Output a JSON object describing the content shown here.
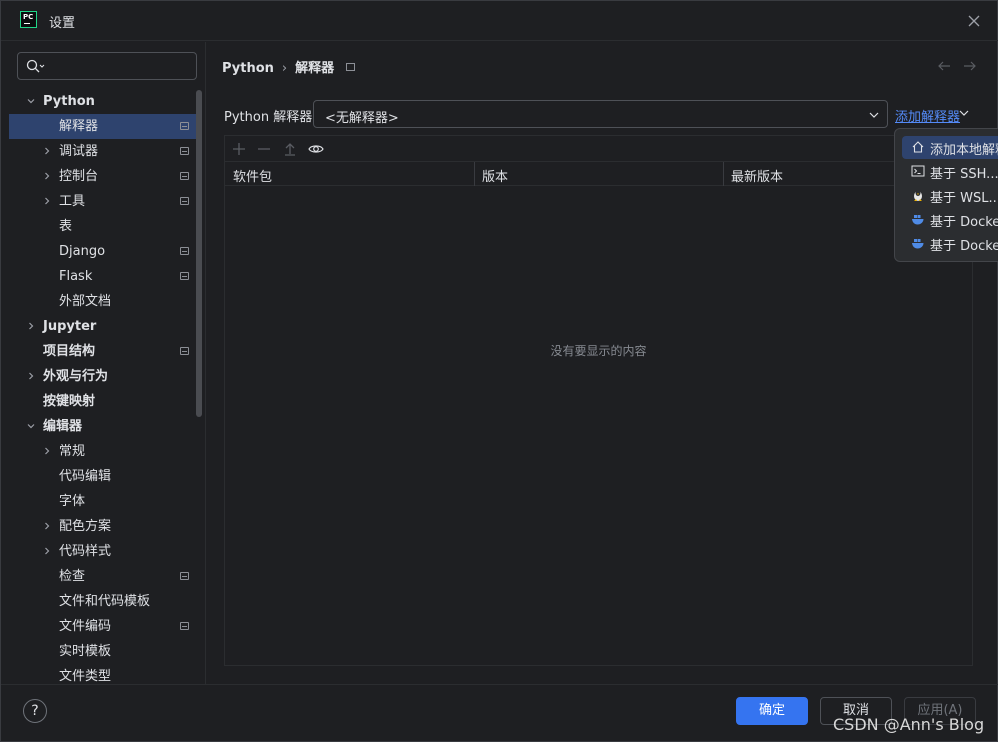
{
  "window": {
    "title": "设置"
  },
  "sidebar": {
    "search_placeholder": "",
    "items": [
      {
        "label": "Python",
        "level": 0,
        "expanded": true,
        "bold": true,
        "pinned": false,
        "selected": false
      },
      {
        "label": "解释器",
        "level": 1,
        "expanded": null,
        "bold": false,
        "pinned": true,
        "selected": true
      },
      {
        "label": "调试器",
        "level": 1,
        "expanded": false,
        "bold": false,
        "pinned": true,
        "selected": false
      },
      {
        "label": "控制台",
        "level": 1,
        "expanded": false,
        "bold": false,
        "pinned": true,
        "selected": false
      },
      {
        "label": "工具",
        "level": 1,
        "expanded": false,
        "bold": false,
        "pinned": true,
        "selected": false
      },
      {
        "label": "表",
        "level": 1,
        "expanded": null,
        "bold": false,
        "pinned": false,
        "selected": false
      },
      {
        "label": "Django",
        "level": 1,
        "expanded": null,
        "bold": false,
        "pinned": true,
        "selected": false
      },
      {
        "label": "Flask",
        "level": 1,
        "expanded": null,
        "bold": false,
        "pinned": true,
        "selected": false
      },
      {
        "label": "外部文档",
        "level": 1,
        "expanded": null,
        "bold": false,
        "pinned": false,
        "selected": false
      },
      {
        "label": "Jupyter",
        "level": 0,
        "expanded": false,
        "bold": true,
        "pinned": false,
        "selected": false
      },
      {
        "label": "项目结构",
        "level": 0,
        "expanded": null,
        "bold": true,
        "pinned": true,
        "selected": false
      },
      {
        "label": "外观与行为",
        "level": 0,
        "expanded": false,
        "bold": true,
        "pinned": false,
        "selected": false
      },
      {
        "label": "按键映射",
        "level": 0,
        "expanded": null,
        "bold": true,
        "pinned": false,
        "selected": false
      },
      {
        "label": "编辑器",
        "level": 0,
        "expanded": true,
        "bold": true,
        "pinned": false,
        "selected": false
      },
      {
        "label": "常规",
        "level": 1,
        "expanded": false,
        "bold": false,
        "pinned": false,
        "selected": false
      },
      {
        "label": "代码编辑",
        "level": 1,
        "expanded": null,
        "bold": false,
        "pinned": false,
        "selected": false
      },
      {
        "label": "字体",
        "level": 1,
        "expanded": null,
        "bold": false,
        "pinned": false,
        "selected": false
      },
      {
        "label": "配色方案",
        "level": 1,
        "expanded": false,
        "bold": false,
        "pinned": false,
        "selected": false
      },
      {
        "label": "代码样式",
        "level": 1,
        "expanded": false,
        "bold": false,
        "pinned": false,
        "selected": false
      },
      {
        "label": "检查",
        "level": 1,
        "expanded": null,
        "bold": false,
        "pinned": true,
        "selected": false
      },
      {
        "label": "文件和代码模板",
        "level": 1,
        "expanded": null,
        "bold": false,
        "pinned": false,
        "selected": false
      },
      {
        "label": "文件编码",
        "level": 1,
        "expanded": null,
        "bold": false,
        "pinned": true,
        "selected": false
      },
      {
        "label": "实时模板",
        "level": 1,
        "expanded": null,
        "bold": false,
        "pinned": false,
        "selected": false
      },
      {
        "label": "文件类型",
        "level": 1,
        "expanded": null,
        "bold": false,
        "pinned": false,
        "selected": false
      }
    ]
  },
  "breadcrumb": {
    "root": "Python",
    "separator": "›",
    "current": "解释器"
  },
  "interpreter": {
    "label": "Python 解释器:",
    "selected_value": "<无解释器>",
    "add_link": "添加解释器"
  },
  "packages": {
    "columns": [
      "软件包",
      "版本",
      "最新版本"
    ],
    "empty_text": "没有要显示的内容"
  },
  "add_menu": {
    "items": [
      {
        "label": "添加本地解释器...",
        "icon": "home-icon"
      },
      {
        "label": "基于 SSH...",
        "icon": "terminal-icon"
      },
      {
        "label": "基于 WSL...",
        "icon": "linux-penguin-icon"
      },
      {
        "label": "基于 Docker...",
        "icon": "docker-icon"
      },
      {
        "label": "基于 Docker Compose...",
        "icon": "docker-icon"
      }
    ]
  },
  "footer": {
    "help_label": "?",
    "ok_label": "确定",
    "cancel_label": "取消",
    "apply_label": "应用(A)",
    "watermark": "CSDN @Ann's Blog"
  },
  "colors": {
    "accent": "#3574f0",
    "link": "#548af7",
    "selection": "#2e436e",
    "background": "#1e1f22"
  }
}
